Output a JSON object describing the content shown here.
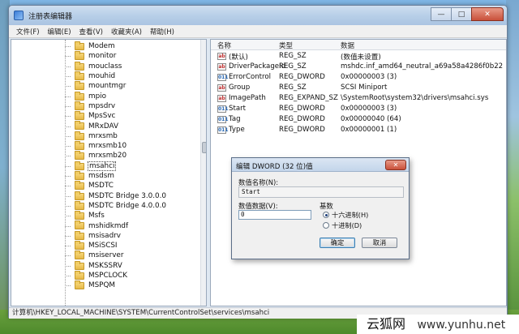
{
  "window": {
    "title": "注册表编辑器",
    "controls": {
      "minimize": "—",
      "maximize": "□",
      "close": "✕"
    }
  },
  "menu": [
    "文件(F)",
    "编辑(E)",
    "查看(V)",
    "收藏夹(A)",
    "帮助(H)"
  ],
  "tree": {
    "selected": "msahci",
    "items": [
      "Modem",
      "monitor",
      "mouclass",
      "mouhid",
      "mountmgr",
      "mpio",
      "mpsdrv",
      "MpsSvc",
      "MRxDAV",
      "mrxsmb",
      "mrxsmb10",
      "mrxsmb20",
      "msahci",
      "msdsm",
      "MSDTC",
      "MSDTC Bridge 3.0.0.0",
      "MSDTC Bridge 4.0.0.0",
      "Msfs",
      "mshidkmdf",
      "msisadrv",
      "MSiSCSI",
      "msiserver",
      "MSKSSRV",
      "MSPCLOCK",
      "MSPQM"
    ]
  },
  "values": {
    "headers": {
      "name": "名称",
      "type": "类型",
      "data": "数据"
    },
    "rows": [
      {
        "icon": "ab",
        "name": "(默认)",
        "type": "REG_SZ",
        "data": "(数值未设置)"
      },
      {
        "icon": "ab",
        "name": "DriverPackageId",
        "type": "REG_SZ",
        "data": "mshdc.inf_amd64_neutral_a69a58a4286f0b22"
      },
      {
        "icon": "bin",
        "name": "ErrorControl",
        "type": "REG_DWORD",
        "data": "0x00000003 (3)"
      },
      {
        "icon": "ab",
        "name": "Group",
        "type": "REG_SZ",
        "data": "SCSI Miniport"
      },
      {
        "icon": "ab",
        "name": "ImagePath",
        "type": "REG_EXPAND_SZ",
        "data": "\\SystemRoot\\system32\\drivers\\msahci.sys"
      },
      {
        "icon": "bin",
        "name": "Start",
        "type": "REG_DWORD",
        "data": "0x00000003 (3)"
      },
      {
        "icon": "bin",
        "name": "Tag",
        "type": "REG_DWORD",
        "data": "0x00000040 (64)"
      },
      {
        "icon": "bin",
        "name": "Type",
        "type": "REG_DWORD",
        "data": "0x00000001 (1)"
      }
    ]
  },
  "statusbar": "计算机\\HKEY_LOCAL_MACHINE\\SYSTEM\\CurrentControlSet\\services\\msahci",
  "dialog": {
    "title": "编辑 DWORD (32 位)值",
    "name_label": "数值名称(N):",
    "name_value": "Start",
    "data_label": "数值数据(V):",
    "data_value": "0",
    "base_label": "基数",
    "hex_label": "十六进制(H)",
    "dec_label": "十进制(D)",
    "hex_checked": true,
    "ok": "确定",
    "cancel": "取消",
    "close": "✕"
  },
  "watermark": {
    "brand": "云狐网",
    "url": "www.yunhu.net"
  }
}
